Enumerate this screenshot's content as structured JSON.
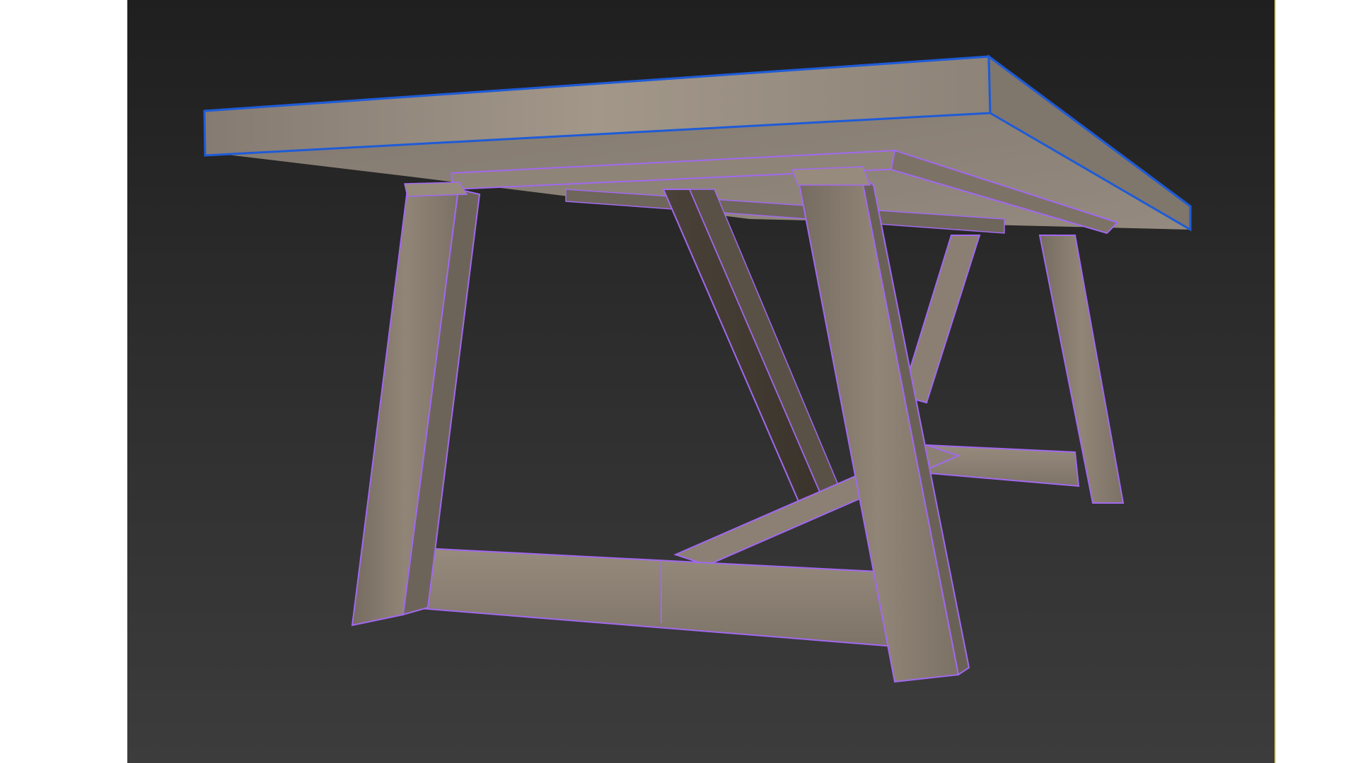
{
  "viewport": {
    "name": "perspective-viewport",
    "background_top": "#1f1f1f",
    "background_bottom": "#3c3c3c",
    "active_border_color": "#e8d84a"
  },
  "scene": {
    "object": "wooden-trestle-table",
    "tabletop_selection_color": "#1e5bd8",
    "leg_wire_color": "#a268f0",
    "wood_color": "#8a7e72"
  }
}
